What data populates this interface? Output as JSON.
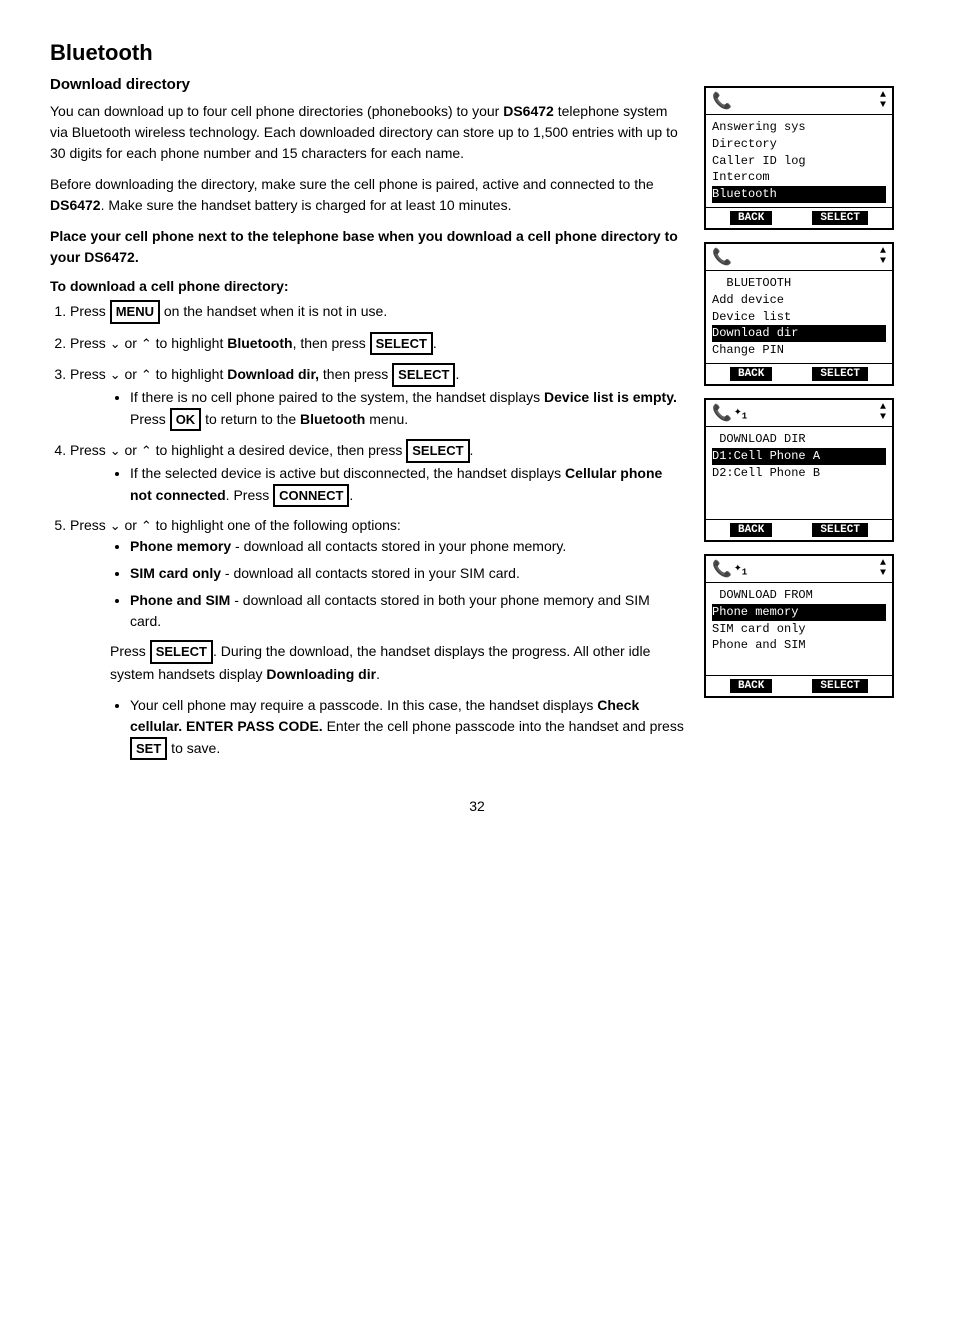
{
  "page": {
    "title": "Bluetooth",
    "section_title": "Download directory",
    "intro_para1": "You can download up to four cell phone directories (phonebooks) to your ",
    "model": "DS6472",
    "intro_para1_cont": " telephone system via Bluetooth wireless technology. Each downloaded directory can store up to 1,500 entries with up to 30 digits for each phone number and 15 characters for each name.",
    "intro_para2": "Before downloading the directory, make sure the cell phone is paired, active and connected to the ",
    "model2": "DS6472",
    "intro_para2_cont": ". Make sure the handset battery is charged for at least 10 minutes.",
    "warning": "Place your cell phone next to the telephone base when you download a cell phone directory to your DS6472.",
    "procedure_title": "To download a cell phone directory:",
    "steps": [
      {
        "id": 1,
        "text_before": "Press ",
        "key": "MENU",
        "text_after": " on the handset when it is not in use."
      },
      {
        "id": 2,
        "text_before": "Press ",
        "arrows": "down/up",
        "text_mid": " or ",
        "text_mid2": " to highlight ",
        "bold_word": "Bluetooth",
        "text_after": ", then press ",
        "key": "SELECT",
        "text_end": "."
      },
      {
        "id": 3,
        "text_before": "Press ",
        "text_mid": " or ",
        "text_mid2": " to highlight ",
        "bold_word": "Download dir,",
        "text_after": " then press ",
        "key": "SELECT",
        "text_end": "."
      },
      {
        "id": 4,
        "text_before": "Press ",
        "text_mid": " or ",
        "text_mid2": " to highlight a desired device, then press ",
        "key": "SELECT",
        "text_end": "."
      },
      {
        "id": 5,
        "text_before": "Press ",
        "text_mid": " or ",
        "text_mid2": " to highlight one of the following options:"
      }
    ],
    "bullet_step3": "If there is no cell phone paired to the system, the handset displays ",
    "bullet_step3_bold": "Device list is empty.",
    "bullet_step3_cont": " Press ",
    "bullet_step3_key": "OK",
    "bullet_step3_end": " to return to the ",
    "bullet_step3_menu": "Bluetooth",
    "bullet_step3_final": " menu.",
    "bullet_step4": "If the selected device is active but disconnected, the handset displays ",
    "bullet_step4_bold": "Cellular phone not connected",
    "bullet_step4_cont": ". Press ",
    "bullet_step4_key": "CONNECT",
    "bullet_step4_end": ".",
    "options": [
      {
        "bold": "Phone memory",
        "text": " - download all contacts stored in your phone memory."
      },
      {
        "bold": "SIM card only",
        "text": " - download all contacts stored in your SIM card."
      },
      {
        "bold": "Phone and SIM",
        "text": " - download all contacts stored in both your phone memory and SIM card."
      }
    ],
    "press_select_note1": "Press ",
    "press_select_key": "SELECT",
    "press_select_note2": ". During the download, the handset displays the progress. All other idle system handsets display ",
    "press_select_bold": "Downloading dir",
    "press_select_end": ".",
    "passcode_bullet1": "Your cell phone may require a passcode. In this case, the handset displays ",
    "passcode_bold1": "Check cellular. ENTER PASS CODE.",
    "passcode_cont": " Enter the cell phone passcode into the handset and press ",
    "passcode_key": "SET",
    "passcode_end": " to save.",
    "page_number": "32",
    "screens": [
      {
        "id": "screen1",
        "header_icon": "handset",
        "show_bt": false,
        "lines": [
          {
            "text": "Answering sys",
            "highlighted": false
          },
          {
            "text": "Directory",
            "highlighted": false
          },
          {
            "text": "Caller ID log",
            "highlighted": false
          },
          {
            "text": "Intercom",
            "highlighted": false
          },
          {
            "text": "Bluetooth",
            "highlighted": true
          }
        ],
        "btn_left": "BACK",
        "btn_right": "SELECT"
      },
      {
        "id": "screen2",
        "header_icon": "handset",
        "show_bt": false,
        "lines": [
          {
            "text": "  BLUETOOTH",
            "highlighted": false
          },
          {
            "text": "Add device",
            "highlighted": false
          },
          {
            "text": "Device list",
            "highlighted": false
          },
          {
            "text": "Download dir",
            "highlighted": true
          },
          {
            "text": "Change PIN",
            "highlighted": false
          }
        ],
        "btn_left": "BACK",
        "btn_right": "SELECT"
      },
      {
        "id": "screen3",
        "header_icon": "handset",
        "show_bt": true,
        "bt_number": "1",
        "lines": [
          {
            "text": "  DOWNLOAD DIR",
            "highlighted": false
          },
          {
            "text": "D1:Cell Phone A",
            "highlighted": true
          },
          {
            "text": "D2:Cell Phone B",
            "highlighted": false
          },
          {
            "text": "",
            "highlighted": false
          },
          {
            "text": "",
            "highlighted": false
          }
        ],
        "btn_left": "BACK",
        "btn_right": "SELECT"
      },
      {
        "id": "screen4",
        "header_icon": "handset",
        "show_bt": true,
        "bt_number": "1",
        "lines": [
          {
            "text": "  DOWNLOAD FROM",
            "highlighted": false
          },
          {
            "text": "Phone memory",
            "highlighted": true
          },
          {
            "text": "SIM card only",
            "highlighted": false
          },
          {
            "text": "Phone and SIM",
            "highlighted": false
          },
          {
            "text": "",
            "highlighted": false
          }
        ],
        "btn_left": "BACK",
        "btn_right": "SELECT"
      }
    ]
  }
}
